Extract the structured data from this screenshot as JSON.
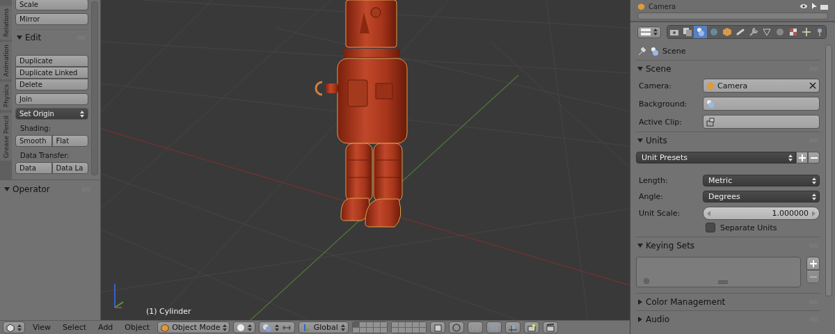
{
  "tool_shelf": {
    "tabs": [
      {
        "label": "Relations",
        "selected": false
      },
      {
        "label": "Animation",
        "selected": false
      },
      {
        "label": "Physics",
        "selected": false
      },
      {
        "label": "Grease Pencil",
        "selected": false
      }
    ],
    "items": [
      {
        "kind": "button",
        "label": "Scale"
      },
      {
        "kind": "button",
        "label": "Mirror"
      },
      {
        "kind": "panel",
        "label": "Edit",
        "expanded": true
      },
      {
        "kind": "stack",
        "labels": [
          "Duplicate",
          "Duplicate Linked",
          "Delete"
        ]
      },
      {
        "kind": "button",
        "label": "Join"
      },
      {
        "kind": "dropdown",
        "label": "Set Origin"
      },
      {
        "kind": "label",
        "label": "Shading:"
      },
      {
        "kind": "row",
        "labels": [
          "Smooth",
          "Flat"
        ]
      },
      {
        "kind": "label",
        "label": "Data Transfer:"
      },
      {
        "kind": "row",
        "labels": [
          "Data",
          "Data La"
        ]
      }
    ],
    "operator": {
      "label": "Operator",
      "expanded": true
    }
  },
  "viewport": {
    "object_label": "(1) Cylinder"
  },
  "header": {
    "menus": [
      "View",
      "Select",
      "Add",
      "Object"
    ],
    "mode": "Object Mode",
    "orientation": "Global"
  },
  "properties": {
    "outliner_row": "Camera",
    "tabs": [
      {
        "kind": "render",
        "selected": false
      },
      {
        "kind": "layers",
        "selected": false
      },
      {
        "kind": "scene",
        "selected": true
      },
      {
        "kind": "world",
        "selected": false
      },
      {
        "kind": "object",
        "selected": false
      },
      {
        "kind": "constraints",
        "selected": false
      },
      {
        "kind": "modifiers",
        "selected": false
      },
      {
        "kind": "data",
        "selected": false
      },
      {
        "kind": "material",
        "selected": false
      },
      {
        "kind": "texture",
        "selected": false
      },
      {
        "kind": "particles",
        "selected": false
      },
      {
        "kind": "physics",
        "selected": false
      }
    ],
    "breadcrumb": "Scene",
    "panels": [
      {
        "title": "Scene",
        "expanded": true,
        "rows": [
          {
            "kind": "object",
            "label": "Camera:",
            "value": "Camera"
          },
          {
            "kind": "object",
            "label": "Background:"
          },
          {
            "kind": "object",
            "label": "Active Clip:"
          }
        ]
      },
      {
        "title": "Units",
        "expanded": true,
        "rows": [
          {
            "kind": "presets",
            "value": "Unit Presets"
          },
          {
            "kind": "dropdown",
            "label": "Length:",
            "value": "Metric"
          },
          {
            "kind": "dropdown",
            "label": "Angle:",
            "value": "Degrees"
          },
          {
            "kind": "number",
            "label": "Unit Scale:",
            "value": "1.000000"
          },
          {
            "kind": "checkbox",
            "label": "Separate Units",
            "checked": false
          }
        ]
      },
      {
        "title": "Keying Sets",
        "expanded": true,
        "rows": [
          {
            "kind": "list"
          }
        ]
      },
      {
        "title": "Color Management",
        "expanded": false
      },
      {
        "title": "Audio",
        "expanded": false
      }
    ]
  }
}
